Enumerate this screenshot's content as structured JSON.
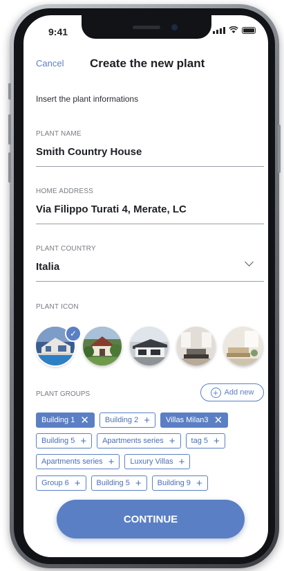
{
  "status": {
    "time": "9:41"
  },
  "header": {
    "cancel": "Cancel",
    "title": "Create the new plant"
  },
  "subtitle": "Insert the plant informations",
  "fields": {
    "plant_name": {
      "label": "PLANT NAME",
      "value": "Smith Country House"
    },
    "home_address": {
      "label": "HOME ADDRESS",
      "value": "Via Filippo Turati 4, Merate, LC"
    },
    "plant_country": {
      "label": "PLANT COUNTRY",
      "value": "Italia"
    }
  },
  "plant_icon": {
    "label": "PLANT ICON",
    "selected_index": 0
  },
  "plant_groups": {
    "label": "PLANT GROUPS",
    "add_new": "Add new",
    "rows": [
      [
        {
          "label": "Building 1",
          "active": true
        },
        {
          "label": "Building 2",
          "active": false
        },
        {
          "label": "Villas Milan3",
          "active": true
        }
      ],
      [
        {
          "label": "Building 5",
          "active": false
        },
        {
          "label": "Apartments series",
          "active": false
        },
        {
          "label": "tag 5",
          "active": false
        }
      ],
      [
        {
          "label": "Apartments series",
          "active": false
        },
        {
          "label": "Luxury Villas",
          "active": false
        }
      ],
      [
        {
          "label": "Group 6",
          "active": false
        },
        {
          "label": "Building 5",
          "active": false
        },
        {
          "label": "Building 9",
          "active": false
        }
      ]
    ]
  },
  "continue_label": "CONTINUE",
  "colors": {
    "accent": "#5a7fc4",
    "text": "#1d1f24"
  }
}
